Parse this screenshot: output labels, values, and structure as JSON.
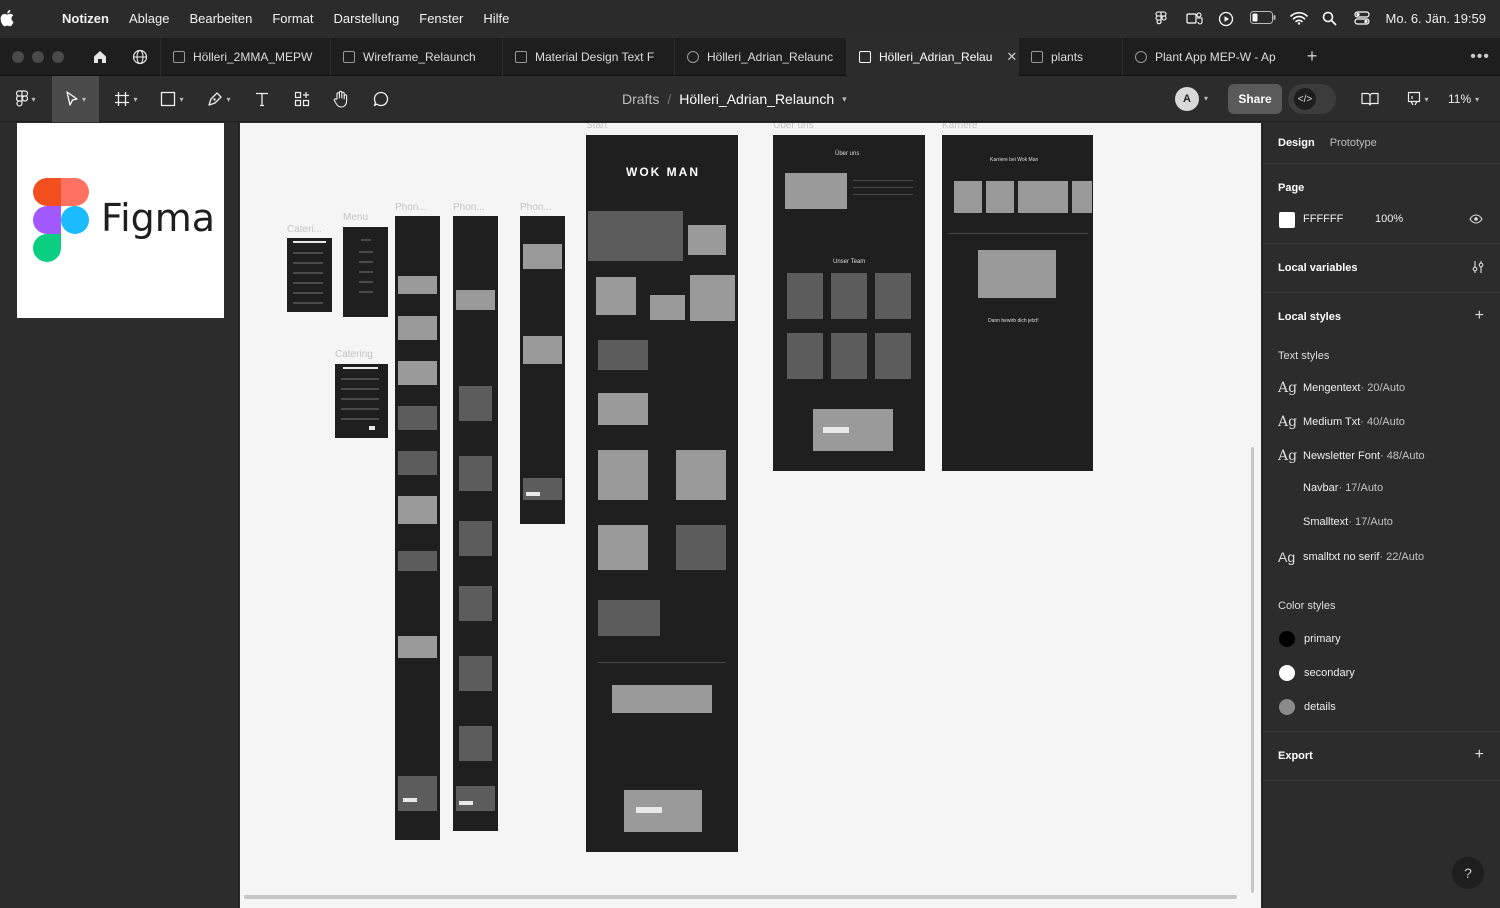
{
  "menubar": {
    "app": "Notizen",
    "items": [
      "Ablage",
      "Bearbeiten",
      "Format",
      "Darstellung",
      "Fenster",
      "Hilfe"
    ],
    "clock": "Mo. 6. Jän.  19:59"
  },
  "tabs": [
    {
      "label": "Hölleri_2MMA_MEPW",
      "icon": "figma-file-icon",
      "active": false
    },
    {
      "label": "Wireframe_Relaunch",
      "icon": "figma-file-icon",
      "active": false
    },
    {
      "label": "Material Design Text F",
      "icon": "figma-file-icon",
      "active": false
    },
    {
      "label": "Hölleri_Adrian_Relaunc",
      "icon": "prototype-play-icon",
      "active": false
    },
    {
      "label": "Hölleri_Adrian_Relau",
      "icon": "figma-file-icon",
      "active": true
    },
    {
      "label": "plants",
      "icon": "figma-file-icon",
      "active": false
    },
    {
      "label": "Plant App MEP-W - Ap",
      "icon": "prototype-play-icon",
      "active": false
    }
  ],
  "toolbar": {
    "breadcrumb_drafts": "Drafts",
    "breadcrumb_sep": "/",
    "file_name": "Hölleri_Adrian_Relaunch",
    "avatar_initial": "A",
    "share_label": "Share",
    "dev_mode_symbol": "</>",
    "zoom": "11%"
  },
  "left_panel": {
    "logo_text": "Figma"
  },
  "canvas": {
    "frame_labels": {
      "catering_small": "Cateri...",
      "menu": "Menu",
      "catering": "Catering",
      "phone1": "Phon...",
      "phone2": "Phon...",
      "phone3": "Phon...",
      "start": "Start",
      "ueber_uns": "Über uns",
      "karriere": "Karriere"
    },
    "desktop_start_title": "WOK MAN",
    "ueber_heading": "Über uns",
    "team_heading": "Unser Team",
    "karriere_heading": "Karriere bei Wok Man",
    "karriere_cta": "Dann bewirb dich jetzt!"
  },
  "right_panel": {
    "tabs": {
      "design": "Design",
      "prototype": "Prototype"
    },
    "page_heading": "Page",
    "page_color": "FFFFFF",
    "page_opacity": "100%",
    "local_variables": "Local variables",
    "local_styles": "Local styles",
    "text_styles_heading": "Text styles",
    "text_styles": [
      {
        "ag": "Ag",
        "name": "Mengentext",
        "meta": " · 20/Auto"
      },
      {
        "ag": "Ag",
        "name": "Medium Txt",
        "meta": " · 40/Auto"
      },
      {
        "ag": "Ag",
        "name": "Newsletter Font",
        "meta": " · 48/Auto"
      },
      {
        "ag": "",
        "name": "Navbar",
        "meta": " · 17/Auto"
      },
      {
        "ag": "",
        "name": "Smalltext",
        "meta": " · 17/Auto"
      },
      {
        "ag": "Ag",
        "name": "smalltxt no serif",
        "meta": " · 22/Auto"
      }
    ],
    "color_styles_heading": "Color styles",
    "color_styles": [
      {
        "name": "primary",
        "color": "#000000"
      },
      {
        "name": "secondary",
        "color": "#ffffff"
      },
      {
        "name": "details",
        "color": "#8a8a8a"
      }
    ],
    "export": "Export",
    "help_symbol": "?"
  }
}
